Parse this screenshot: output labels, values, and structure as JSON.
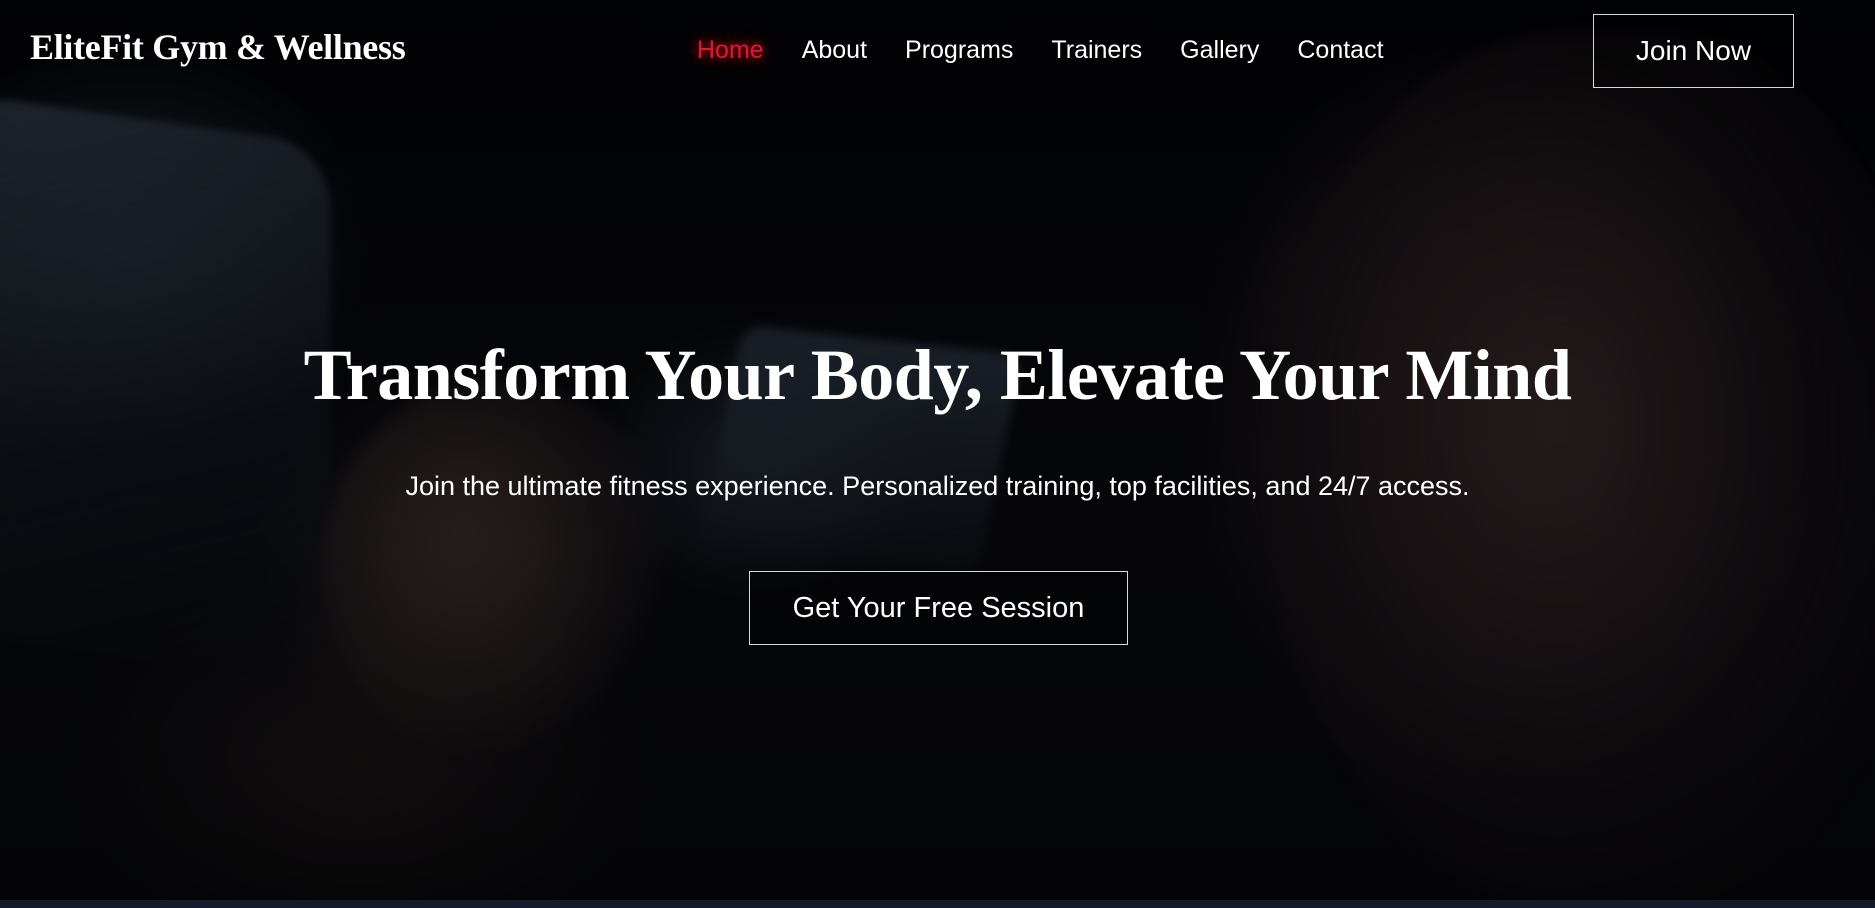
{
  "header": {
    "brand": "EliteFit Gym & Wellness",
    "nav": [
      {
        "label": "Home",
        "active": true
      },
      {
        "label": "About",
        "active": false
      },
      {
        "label": "Programs",
        "active": false
      },
      {
        "label": "Trainers",
        "active": false
      },
      {
        "label": "Gallery",
        "active": false
      },
      {
        "label": "Contact",
        "active": false
      }
    ],
    "join_label": "Join Now"
  },
  "hero": {
    "title": "Transform Your Body, Elevate Your Mind",
    "subtitle": "Join the ultimate fitness experience. Personalized training, top facilities, and 24/7 access.",
    "cta_label": "Get Your Free Session"
  },
  "colors": {
    "accent": "#e0172f",
    "text": "#ffffff",
    "background": "#050608",
    "bottom_strip": "#141b2b"
  }
}
